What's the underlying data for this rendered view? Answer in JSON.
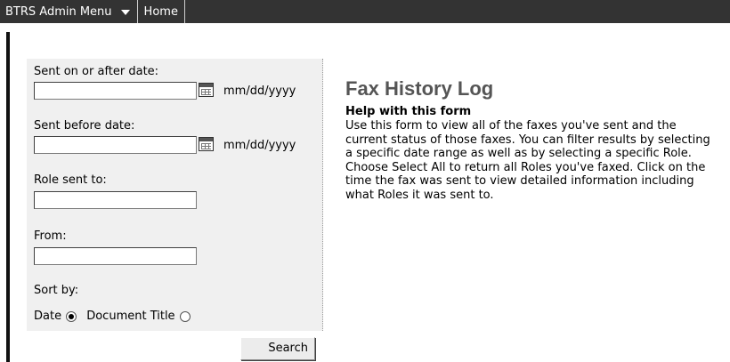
{
  "menu": {
    "admin_label": "BTRS Admin Menu",
    "home_label": "Home"
  },
  "form": {
    "sent_after_label": "Sent on or after date:",
    "sent_after_value": "",
    "sent_after_format": "mm/dd/yyyy",
    "sent_before_label": "Sent before date:",
    "sent_before_value": "",
    "sent_before_format": "mm/dd/yyyy",
    "role_label": "Role sent to:",
    "role_value": "",
    "from_label": "From:",
    "from_value": "",
    "sort_label": "Sort by:",
    "sort_options": [
      {
        "label": "Date",
        "selected": true
      },
      {
        "label": "Document Title",
        "selected": false
      }
    ],
    "search_label": "Search"
  },
  "help": {
    "title": "Fax History Log",
    "heading": "Help with this form",
    "text": "Use this form to view all of the faxes you've sent and the current status of those faxes. You can filter results by selecting a specific date range as well as by selecting a specific Role. Choose Select All to return all Roles you've faxed. Click on the time the fax was sent to view detailed information including what Roles it was sent to."
  },
  "icons": [
    "calendar-icon",
    "chevron-down-icon"
  ],
  "colors": {
    "topbar": "#333333",
    "panel": "#f0f0f0",
    "title": "#555555"
  }
}
